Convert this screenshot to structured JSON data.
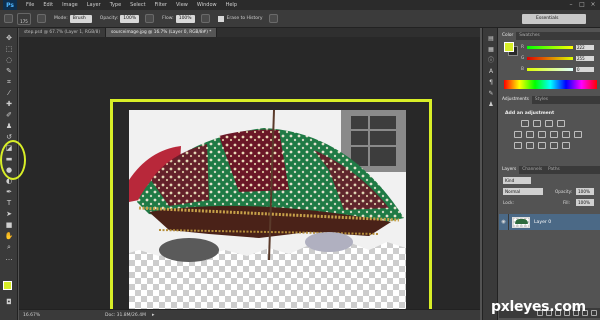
{
  "app": {
    "logo": "Ps"
  },
  "menu": [
    "File",
    "Edit",
    "Image",
    "Layer",
    "Type",
    "Select",
    "Filter",
    "View",
    "Window",
    "Help"
  ],
  "options_bar": {
    "size_value": "175",
    "mode_label": "Mode:",
    "mode_value": "Brush",
    "opacity_label": "Opacity:",
    "opacity_value": "100%",
    "flow_label": "Flow:",
    "flow_value": "100%",
    "erase_history_label": "Erase to History",
    "workspace": "Essentials"
  },
  "doc_tabs": [
    {
      "label": "step.psd @ 67.7% (Layer 1, RGB/8)"
    },
    {
      "label": "sourceimage.jpg @ 16.7% (Layer 0, RGB/8#) *"
    }
  ],
  "status": {
    "zoom": "16.67%",
    "doc": "Doc: 31.8M/26.4M"
  },
  "color_panel": {
    "tabs": [
      "Color",
      "Swatches"
    ],
    "sliders": [
      {
        "label": "R",
        "value": "222"
      },
      {
        "label": "G",
        "value": "255"
      },
      {
        "label": "B",
        "value": "0"
      }
    ],
    "foreground": "#d8ee27"
  },
  "adjustments_panel": {
    "tabs": [
      "Adjustments",
      "Styles"
    ],
    "title": "Add an adjustment"
  },
  "layers_panel": {
    "tabs": [
      "Layers",
      "Channels",
      "Paths"
    ],
    "kind_label": "Kind",
    "blend_mode": "Normal",
    "opacity_label": "Opacity:",
    "opacity_value": "100%",
    "lock_label": "Lock:",
    "fill_label": "Fill:",
    "fill_value": "100%",
    "layer_name": "Layer 0"
  },
  "watermark": "pxleyes.com",
  "colors": {
    "highlight": "#d8ee27",
    "app_bg": "#535353",
    "canvas_bg": "#282828",
    "selected_layer": "#4b6986"
  }
}
